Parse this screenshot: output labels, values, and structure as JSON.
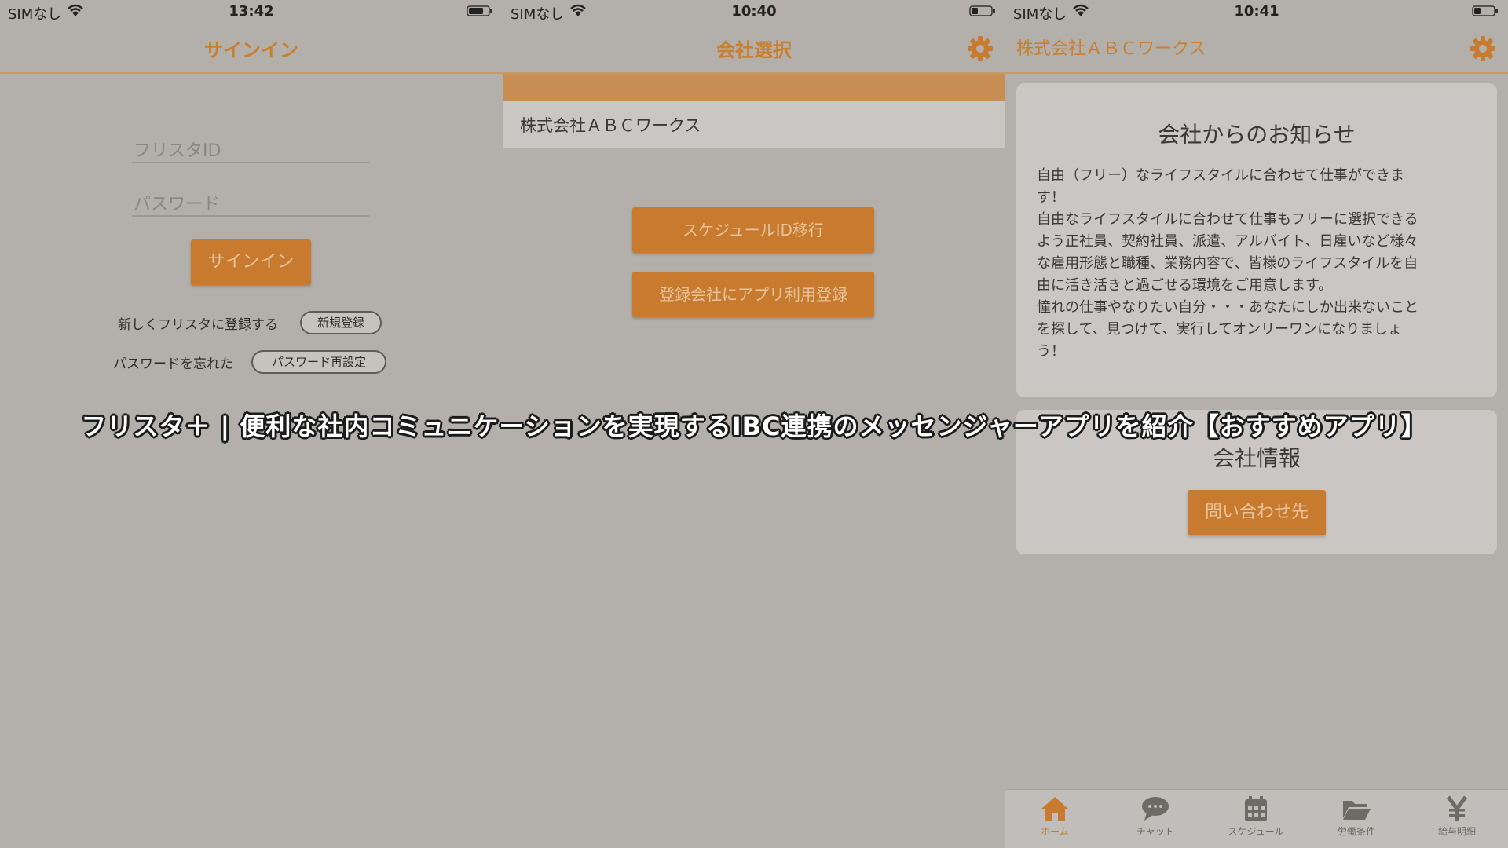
{
  "screen1": {
    "status": {
      "carrier": "SIMなし",
      "time": "13:42"
    },
    "title": "サインイン",
    "id_placeholder": "フリスタID",
    "password_placeholder": "パスワード",
    "signin_button": "サインイン",
    "register_text": "新しくフリスタに登録する",
    "register_button": "新規登録",
    "forgot_text": "パスワードを忘れた",
    "reset_button": "パスワード再設定"
  },
  "screen2": {
    "status": {
      "carrier": "SIMなし",
      "time": "10:40"
    },
    "title": "会社選択",
    "company": "株式会社ＡＢＣワークス",
    "button_migrate": "スケジュールID移行",
    "button_register": "登録会社にアプリ利用登録"
  },
  "screen3": {
    "status": {
      "carrier": "SIMなし",
      "time": "10:41"
    },
    "title": "株式会社ＡＢＣワークス",
    "notice_title": "会社からのお知らせ",
    "notice_lines": [
      "自由（フリー）なライフスタイルに合わせて仕事ができま",
      "す！",
      "自由なライフスタイルに合わせて仕事もフリーに選択できる",
      "よう正社員、契約社員、派遣、アルバイト、日雇いなど様々",
      "な雇用形態と職種、業務内容で、皆様のライフスタイルを自",
      "由に活き活きと過ごせる環境をご用意します。",
      "憧れの仕事やなりたい自分・・・あなたにしか出来ないこと",
      "を探して、見つけて、実行してオンリーワンになりましょ",
      "う！"
    ],
    "info_title": "会社情報",
    "contact_button": "問い合わせ先",
    "tabs": [
      {
        "label": "ホーム",
        "icon": "home-icon"
      },
      {
        "label": "チャット",
        "icon": "chat-icon"
      },
      {
        "label": "スケジュール",
        "icon": "calendar-icon"
      },
      {
        "label": "労働条件",
        "icon": "folder-icon"
      },
      {
        "label": "給与明細",
        "icon": "yen-icon"
      }
    ],
    "accent_color": "#c87b2e"
  },
  "overlay_title": "フリスタ＋ | 便利な社内コミュニケーションを実現するIBC連携のメッセンジャーアプリを紹介【おすすめアプリ】"
}
